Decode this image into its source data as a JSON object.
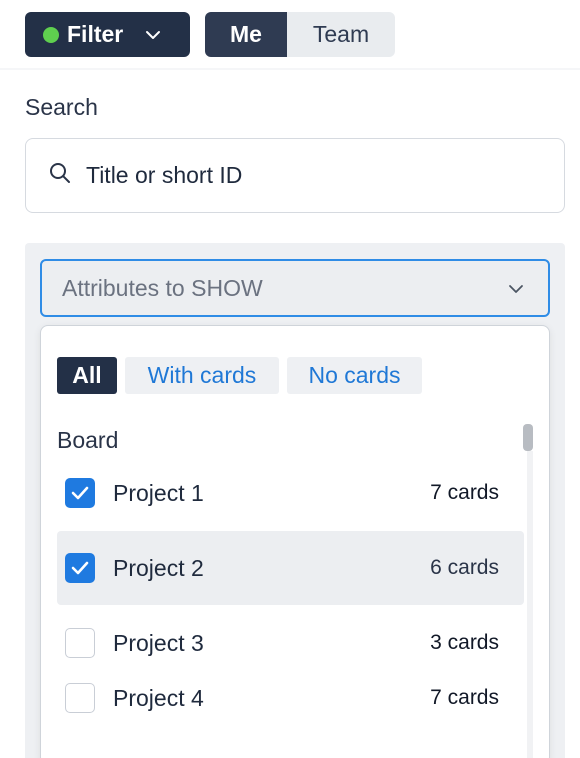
{
  "topbar": {
    "filter_label": "Filter",
    "filter_status_color": "#5fcf4f",
    "filter_chevron_icon": "chevron-down-icon",
    "scope_options": [
      "Me",
      "Team"
    ],
    "scope_selected": "Me"
  },
  "search": {
    "label": "Search",
    "placeholder": "Title or short ID",
    "value": "",
    "icon": "search-icon"
  },
  "attributes_select": {
    "placeholder": "Attributes to SHOW",
    "focused": true,
    "chevron_icon": "chevron-down-icon",
    "accent_color": "#2f8ce6"
  },
  "dropdown": {
    "tabs": [
      {
        "label": "All",
        "selected": true
      },
      {
        "label": "With cards",
        "selected": false
      },
      {
        "label": "No cards",
        "selected": false
      }
    ],
    "group_label": "Board",
    "items": [
      {
        "label": "Project 1",
        "count": "7 cards",
        "checked": true,
        "highlighted": false
      },
      {
        "label": "Project 2",
        "count": "6 cards",
        "checked": true,
        "highlighted": true
      },
      {
        "label": "Project 3",
        "count": "3 cards",
        "checked": false,
        "highlighted": false
      },
      {
        "label": "Project 4",
        "count": "7 cards",
        "checked": false,
        "highlighted": false
      }
    ],
    "check_color": "#1f7ae0"
  }
}
